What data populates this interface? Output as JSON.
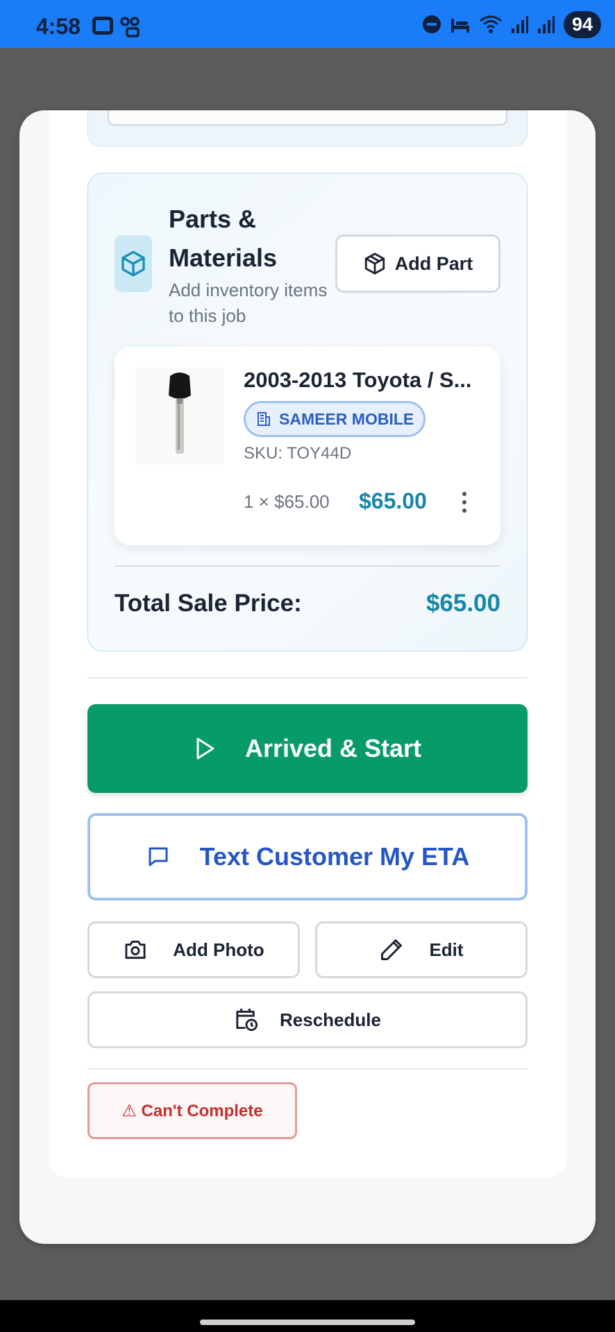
{
  "status_bar": {
    "time": "4:58",
    "battery": "94",
    "icons": [
      "google-icon",
      "voicemail-icon",
      "do-not-disturb-icon",
      "bed-icon",
      "wifi-icon",
      "signal-icon",
      "signal-icon"
    ]
  },
  "parts": {
    "title": "Parts & Materials",
    "subtitle": "Add inventory items to this job",
    "add_part_label": "Add Part",
    "icon": "package-icon",
    "items": [
      {
        "title": "2003-2013 Toyota / S...",
        "vendor": "SAMEER MOBILE",
        "sku": "SKU: TOY44D",
        "qty_price": "1 × $65.00",
        "line_total": "$65.00"
      }
    ],
    "total_label": "Total Sale Price:",
    "total_value": "$65.00"
  },
  "actions": {
    "arrived_label": "Arrived & Start",
    "eta_label": "Text Customer My ETA",
    "add_photo_label": "Add Photo",
    "edit_label": "Edit",
    "reschedule_label": "Reschedule",
    "cant_complete_label": "⚠ Can't Complete"
  },
  "colors": {
    "status_bar": "#1a7cf7",
    "primary_green": "#079a6a",
    "accent_blue": "#2457c5",
    "price_teal": "#1687a8",
    "danger_red": "#c62f2f"
  }
}
